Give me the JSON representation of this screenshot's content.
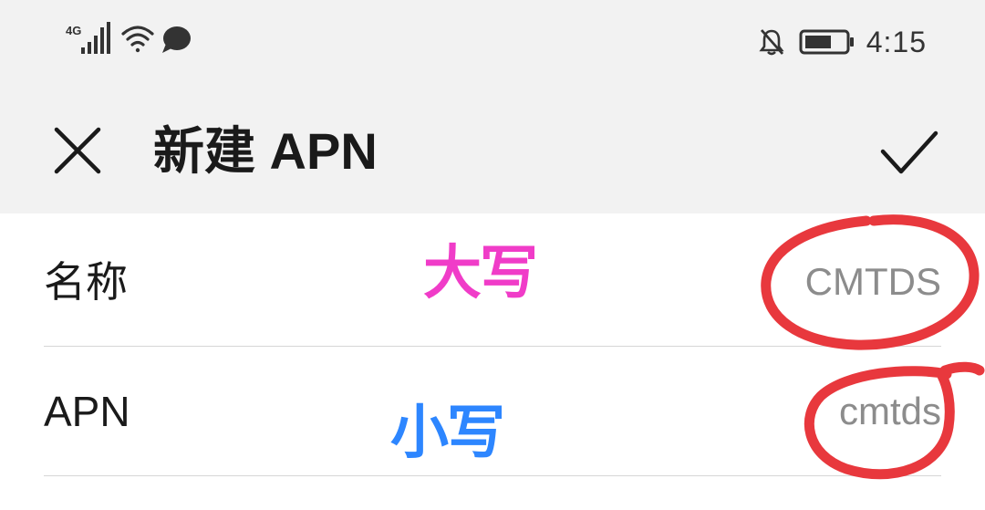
{
  "status_bar": {
    "network": "4G",
    "time": "4:15",
    "icons": [
      "signal-icon",
      "wifi-icon",
      "message-bubble-icon",
      "notifications-off-icon",
      "battery-icon"
    ]
  },
  "toolbar": {
    "title": "新建 APN",
    "close_icon": "close-icon",
    "confirm_icon": "checkmark-icon"
  },
  "fields": [
    {
      "label": "名称",
      "value": "CMTDS"
    },
    {
      "label": "APN",
      "value": "cmtds"
    }
  ],
  "annotations": {
    "uppercase_note": "大写",
    "lowercase_note": "小写",
    "circle_color": "#e8383d",
    "uppercase_color": "#f03cc8",
    "lowercase_color": "#2d86ff"
  }
}
